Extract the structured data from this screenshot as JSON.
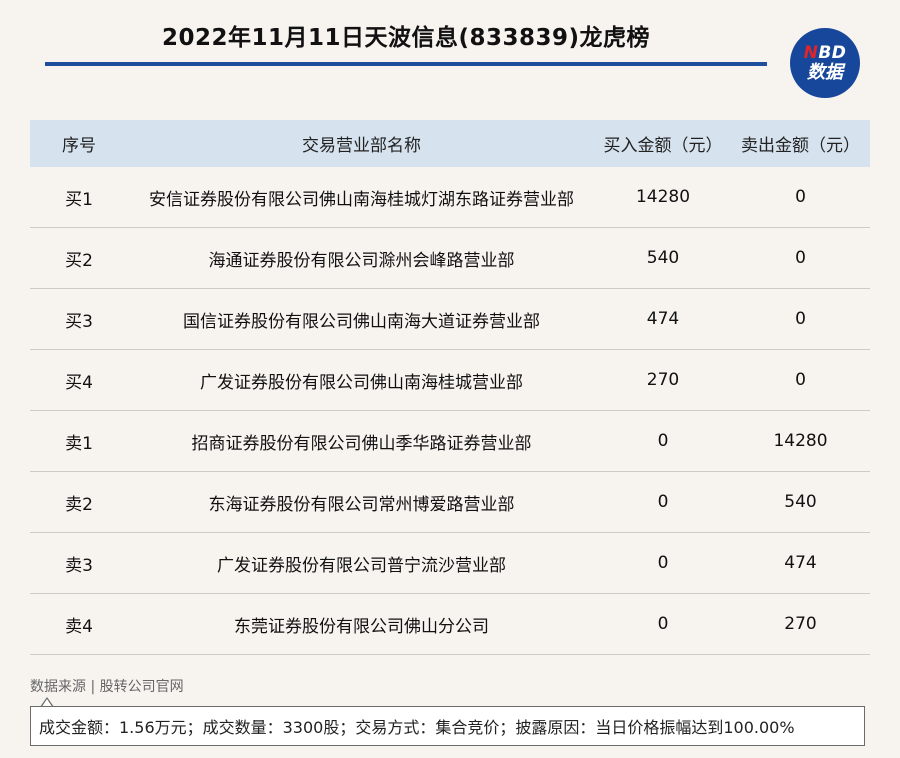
{
  "header": {
    "title": "2022年11月11日天波信息(833839)龙虎榜",
    "logo_line1_accent": "N",
    "logo_line1_rest": "BD",
    "logo_line2": "数据",
    "rule_color": "#1f4e9c",
    "logo_color": "#17479a"
  },
  "table": {
    "headers": [
      "序号",
      "交易营业部名称",
      "买入金额（元）",
      "卖出金额（元）"
    ],
    "rows": [
      {
        "no": "买1",
        "name": "安信证券股份有限公司佛山南海桂城灯湖东路证券营业部",
        "buy": "14280",
        "sell": "0"
      },
      {
        "no": "买2",
        "name": "海通证券股份有限公司滁州会峰路营业部",
        "buy": "540",
        "sell": "0"
      },
      {
        "no": "买3",
        "name": "国信证券股份有限公司佛山南海大道证券营业部",
        "buy": "474",
        "sell": "0"
      },
      {
        "no": "买4",
        "name": "广发证券股份有限公司佛山南海桂城营业部",
        "buy": "270",
        "sell": "0"
      },
      {
        "no": "卖1",
        "name": "招商证券股份有限公司佛山季华路证券营业部",
        "buy": "0",
        "sell": "14280"
      },
      {
        "no": "卖2",
        "name": "东海证券股份有限公司常州博爱路营业部",
        "buy": "0",
        "sell": "540"
      },
      {
        "no": "卖3",
        "name": "广发证券股份有限公司普宁流沙营业部",
        "buy": "0",
        "sell": "474"
      },
      {
        "no": "卖4",
        "name": "东莞证券股份有限公司佛山分公司",
        "buy": "0",
        "sell": "270"
      }
    ]
  },
  "footer": {
    "source": "数据来源 | 股转公司官网",
    "note": "成交金额：1.56万元；成交数量：3300股；交易方式：集合竞价；披露原因：当日价格振幅达到100.00%"
  }
}
